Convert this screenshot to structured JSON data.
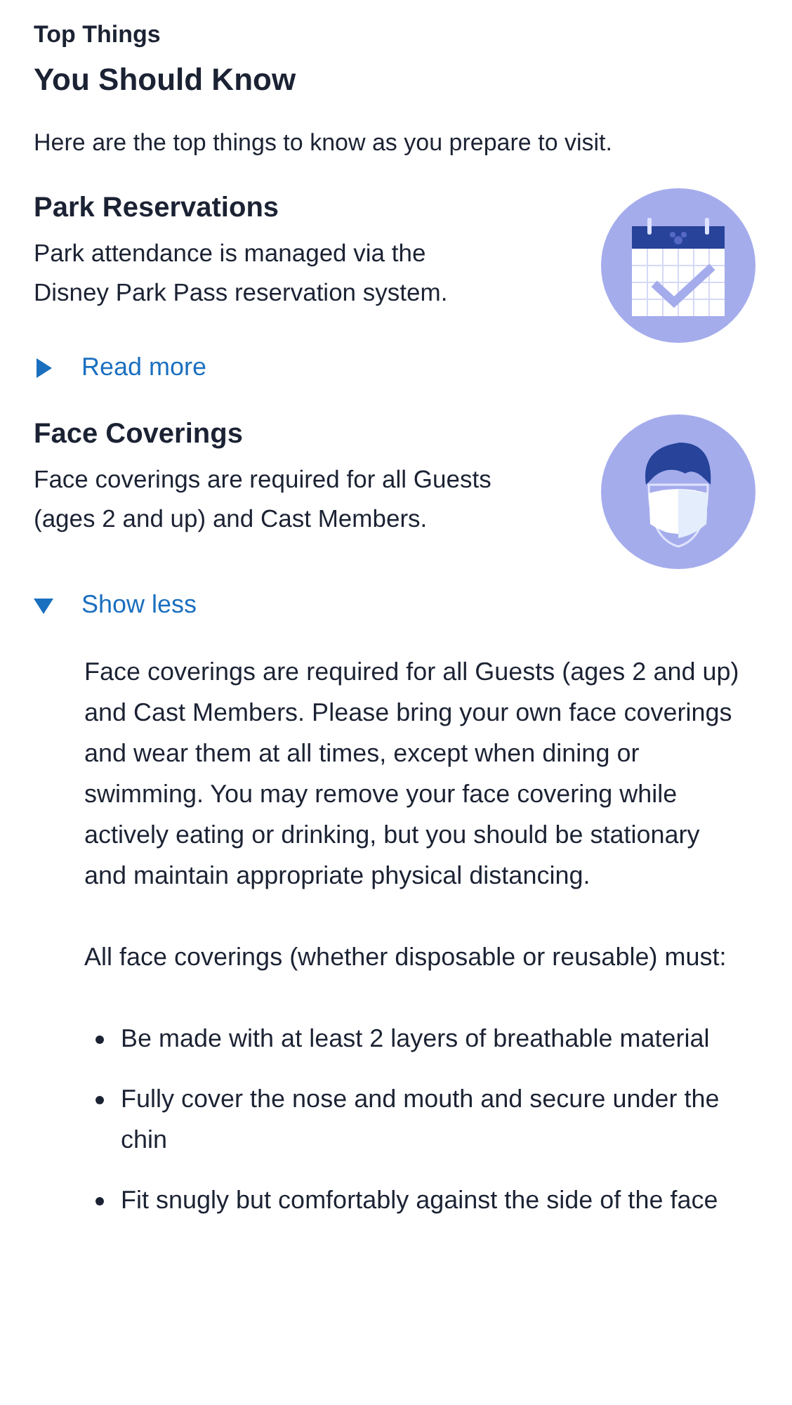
{
  "header": {
    "eyebrow": "Top Things",
    "title": "You Should Know",
    "intro": "Here are the top things to know as you prepare to visit."
  },
  "items": [
    {
      "title": "Park Reservations",
      "summary": "Park attendance is managed via the Disney Park Pass reservation system.",
      "kind": "calendar",
      "expanded": false,
      "toggle_label": "Read more"
    },
    {
      "title": "Face Coverings",
      "summary": "Face coverings are required for all Guests (ages 2 and up) and Cast Members.",
      "kind": "face-mask",
      "expanded": true,
      "toggle_label": "Show less",
      "details": {
        "paragraphs": [
          "Face coverings are required for all Guests (ages 2 and up) and Cast Members. Please bring your own face coverings and wear them at all times, except when dining or swimming. You may remove your face covering while actively eating or drinking, but you should be stationary and maintain appropriate physical distancing.",
          "All face coverings (whether disposable or reusable) must:"
        ],
        "bullets": [
          "Be made with at least 2 layers of breathable material",
          "Fully cover the nose and mouth and secure under the chin",
          "Fit snugly but comfortably against the side of the face"
        ]
      }
    }
  ]
}
